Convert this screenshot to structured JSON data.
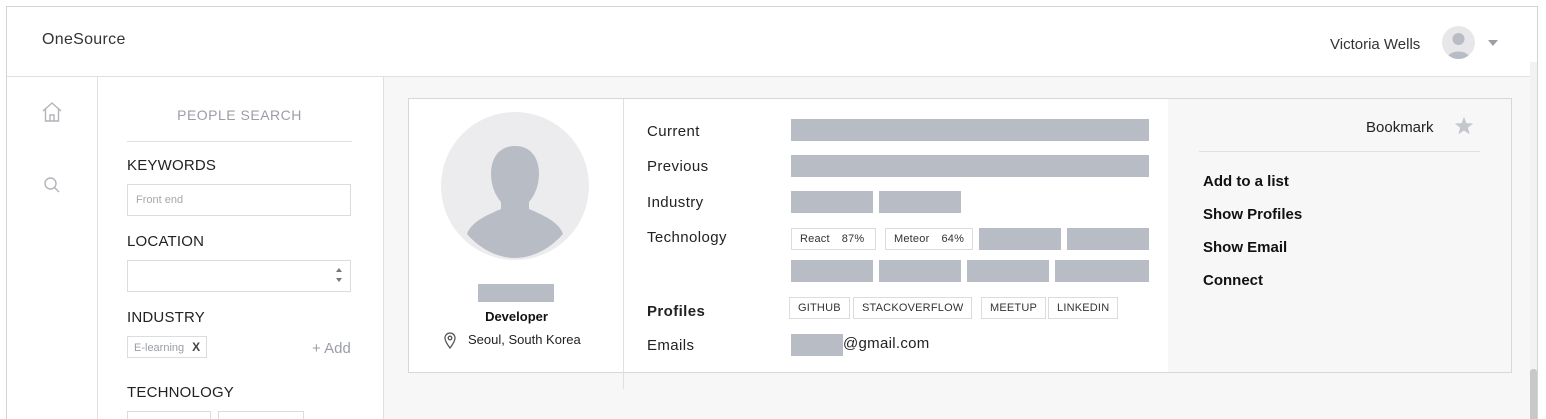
{
  "header": {
    "brand": "OneSource",
    "user_name": "Victoria Wells"
  },
  "rail": {
    "items": [
      {
        "icon": "home-icon"
      },
      {
        "icon": "search-icon"
      }
    ]
  },
  "search_panel": {
    "title": "PEOPLE SEARCH",
    "keywords_label": "KEYWORDS",
    "keywords_placeholder": "Front end",
    "location_label": "LOCATION",
    "location_value": "",
    "industry_label": "INDUSTRY",
    "industry_tag": "E-learning",
    "industry_tag_remove": "X",
    "industry_add": "+ Add",
    "technology_label": "TECHNOLOGY"
  },
  "profile": {
    "role": "Developer",
    "location": "Seoul, South Korea",
    "labels": {
      "current": "Current",
      "previous": "Previous",
      "industry": "Industry",
      "technology": "Technology",
      "profiles": "Profiles",
      "emails": "Emails"
    },
    "technologies": [
      {
        "name": "React",
        "percent": "87%"
      },
      {
        "name": "Meteor",
        "percent": "64%"
      }
    ],
    "profile_links": [
      "GITHUB",
      "STACKOVERFLOW",
      "MEETUP",
      "LINKEDIN"
    ],
    "email_domain": "@gmail.com"
  },
  "actions": {
    "bookmark": "Bookmark",
    "add_to_list": "Add to a list",
    "show_profiles": "Show Profiles",
    "show_email": "Show Email",
    "connect": "Connect"
  },
  "colors": {
    "placeholder_bar": "#b8bcc4",
    "border": "#dadce0",
    "muted_text": "#9a9ea5",
    "panel_bg": "#f7f7f8"
  }
}
